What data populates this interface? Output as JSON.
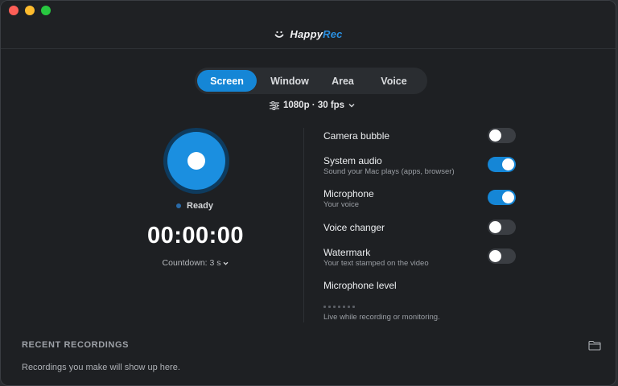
{
  "app": {
    "logo_part1": "Happy",
    "logo_part2": "Rec",
    "brand_color": "#2a8fe0"
  },
  "modes": [
    {
      "label": "Screen",
      "active": true
    },
    {
      "label": "Window",
      "active": false
    },
    {
      "label": "Area",
      "active": false
    },
    {
      "label": "Voice",
      "active": false
    }
  ],
  "quality": {
    "label": "1080p · 30 fps",
    "icon": "sliders-icon"
  },
  "recorder": {
    "status": "Ready",
    "timer": "00:00:00",
    "countdown": "Countdown: 3 s"
  },
  "options": [
    {
      "label": "Camera bubble",
      "sub": "",
      "on": false
    },
    {
      "label": "System audio",
      "sub": "Sound your Mac plays (apps, browser)",
      "on": true
    },
    {
      "label": "Microphone",
      "sub": "Your voice",
      "on": true
    },
    {
      "label": "Voice changer",
      "sub": "",
      "on": false
    },
    {
      "label": "Watermark",
      "sub": "Your text stamped on the video",
      "on": false
    }
  ],
  "mic_level": {
    "label": "Microphone level",
    "hint": "Live while recording or monitoring."
  },
  "recent": {
    "title": "RECENT RECORDINGS",
    "empty": "Recordings you make will show up here.",
    "icon": "folder-icon"
  },
  "colors": {
    "accent": "#1586d6",
    "background": "#1e2023"
  }
}
